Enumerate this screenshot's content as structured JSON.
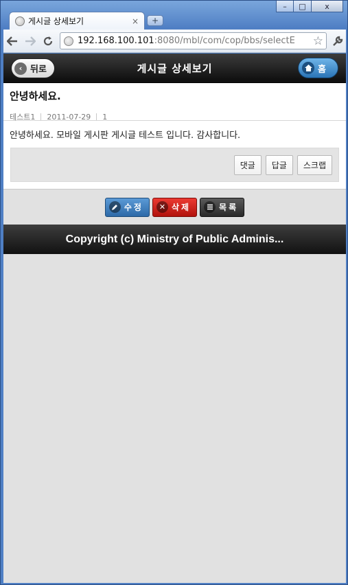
{
  "browser": {
    "tab_title": "게시글 상세보기",
    "tab_close": "×",
    "new_tab": "+",
    "url_host": "192.168.100.101",
    "url_rest": ":8080/mbl/com/cop/bbs/selectE",
    "win_minimize": "–",
    "win_maximize": "□",
    "win_close": "x"
  },
  "header": {
    "title": "게시글 상세보기",
    "back_label": "뒤로",
    "home_label": "홈"
  },
  "post": {
    "title": "안녕하세요.",
    "author": "테스트1",
    "date": "2011-07-29",
    "views": "1",
    "body": "안녕하세요. 모바일 게시판 게시글 테스트 입니다. 감사합니다."
  },
  "actions": {
    "comment": "댓글",
    "reply": "답글",
    "scrap": "스크랩"
  },
  "buttons": {
    "edit": "수정",
    "delete": "삭제",
    "list": "목록"
  },
  "footer": {
    "copyright": "Copyright (c) Ministry of Public Adminis..."
  },
  "colors": {
    "edit_button": "#3a7ab9",
    "delete_button": "#d21f18",
    "list_button": "#3a3a3a",
    "home_button": "#2a74b6"
  },
  "icons": {
    "back": "chevron-left-icon",
    "home": "house-icon",
    "edit": "pencil-icon",
    "delete": "x-icon",
    "list": "list-icon"
  }
}
